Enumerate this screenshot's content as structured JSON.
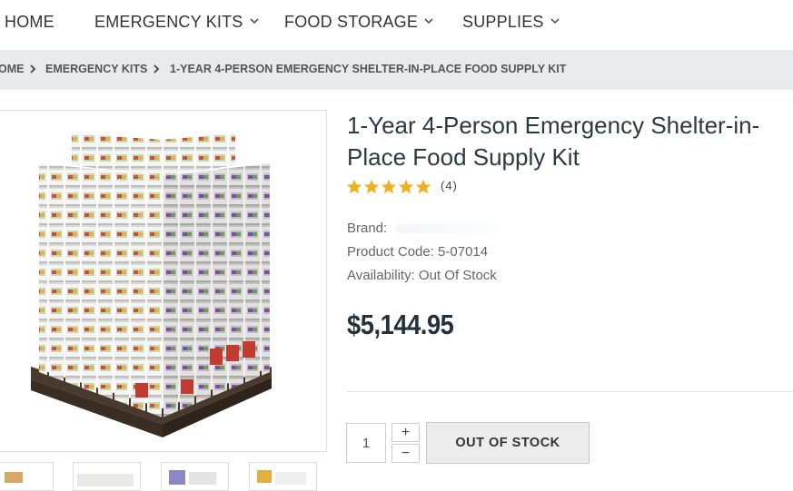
{
  "nav": {
    "items": [
      {
        "label": "HOME"
      },
      {
        "label": "EMERGENCY KITS"
      },
      {
        "label": "FOOD STORAGE"
      },
      {
        "label": "SUPPLIES"
      }
    ]
  },
  "breadcrumb": {
    "items": [
      {
        "label": "OME"
      },
      {
        "label": "EMERGENCY KITS"
      },
      {
        "label": "1-YEAR 4-PERSON EMERGENCY SHELTER-IN-PLACE FOOD SUPPLY KIT"
      }
    ]
  },
  "product": {
    "title": "1-Year 4-Person Emergency Shelter-in-Place Food Supply Kit",
    "rating": 5,
    "review_count": "(4)",
    "brand_label": "Brand:",
    "product_code": "Product Code: 5-07014",
    "availability": "Availability: Out Of Stock",
    "price": "$5,144.95",
    "quantity": "1",
    "increment_label": "+",
    "decrement_label": "−",
    "button_label": "OUT OF STOCK"
  },
  "colors": {
    "title": "#2b3a42",
    "star": "#f2b01e",
    "breadcrumb_bg": "#e8ebec",
    "button_bg": "#ececec"
  },
  "icons": [
    "chevron-down-icon",
    "chevron-right-icon",
    "star-icon"
  ]
}
